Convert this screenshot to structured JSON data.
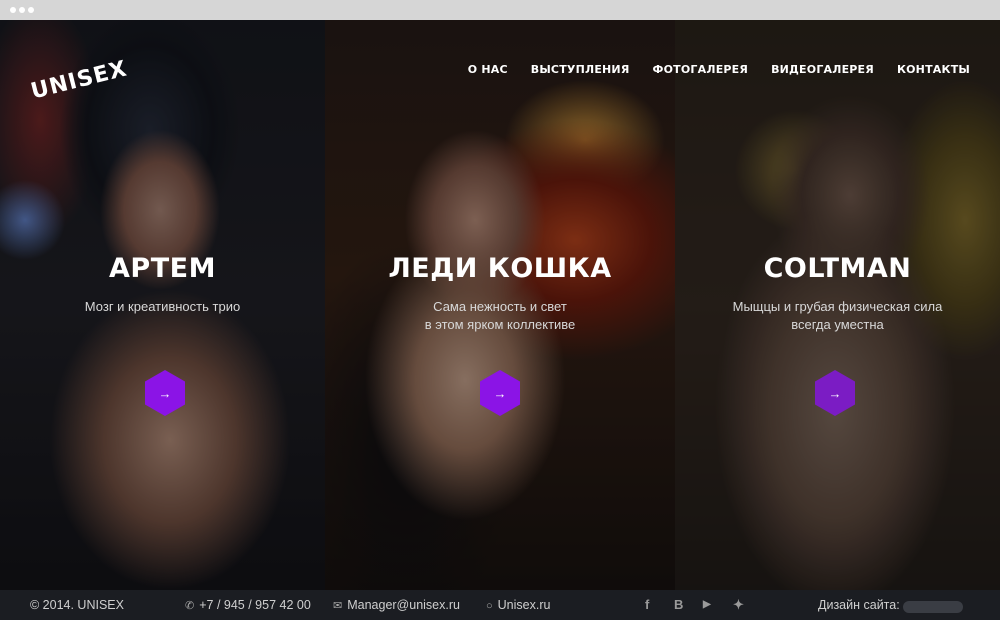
{
  "brand": {
    "logo": "UNISEX",
    "accent_color": "#8b14e6"
  },
  "nav": {
    "items": [
      "О НАС",
      "ВЫСТУПЛЕНИЯ",
      "ФОТОГАЛЕРЕЯ",
      "ВИДЕОГАЛЕРЕЯ",
      "КОНТАКТЫ"
    ]
  },
  "performers": [
    {
      "name": "АРТЕМ",
      "desc_line1": "Мозг и креативность трио",
      "desc_line2": "",
      "arrow": "→"
    },
    {
      "name": "ЛЕДИ КОШКА",
      "desc_line1": "Сама нежность и свет",
      "desc_line2": "в этом ярком коллективе",
      "arrow": "→"
    },
    {
      "name": "COLTMAN",
      "desc_line1": "Мыщцы и грубая физическая сила",
      "desc_line2": "всегда уместна",
      "arrow": "→"
    }
  ],
  "footer": {
    "copyright": "© 2014. UNISEX",
    "phone": "+7 / 945 / 957 42 00",
    "email": "Manager@unisex.ru",
    "skype": "Unisex.ru",
    "social": [
      "facebook-icon",
      "vk-icon",
      "youtube-icon",
      "twitter-icon"
    ],
    "design_label": "Дизайн сайта:",
    "icons": {
      "phone": "phone-icon",
      "email": "email-icon",
      "skype": "skype-icon"
    }
  }
}
